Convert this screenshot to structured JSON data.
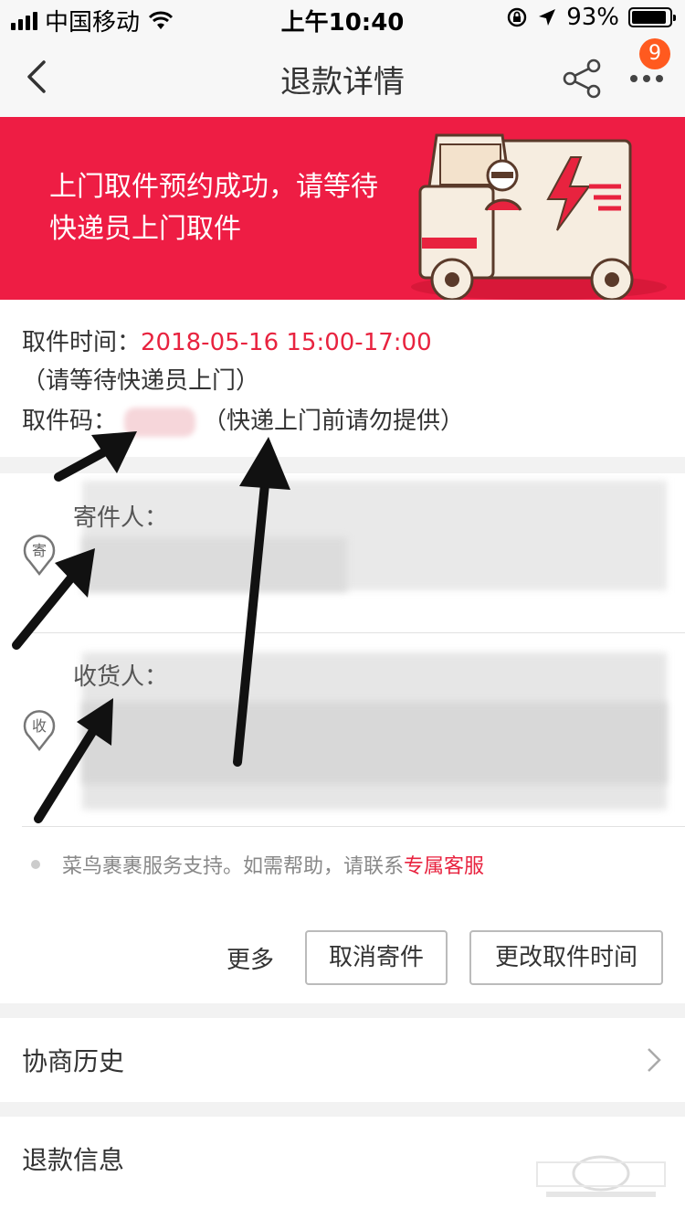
{
  "status_bar": {
    "carrier": "中国移动",
    "time": "上午10:40",
    "battery_percent": "93%",
    "battery_level": 0.93
  },
  "nav": {
    "title": "退款详情",
    "badge_count": "9"
  },
  "banner": {
    "message": "上门取件预约成功，请等待快递员上门取件"
  },
  "pickup": {
    "time_label": "取件时间：",
    "time_value": "2018-05-16 15:00-17:00",
    "time_note": "（请等待快递员上门）",
    "code_label": "取件码：",
    "code_note": "（快递上门前请勿提供）"
  },
  "address": {
    "sender_icon": "寄",
    "sender_label": "寄件人：",
    "receiver_icon": "收",
    "receiver_label": "收货人：",
    "support_text": "菜鸟裹裹服务支持。如需帮助，请联系",
    "support_link": "专属客服"
  },
  "actions": {
    "more": "更多",
    "cancel": "取消寄件",
    "change_time": "更改取件时间"
  },
  "rows": {
    "history": "协商历史",
    "refund_info": "退款信息"
  },
  "colors": {
    "banner": "#ee1d44",
    "accent_red": "#e8233f",
    "badge": "#ff5a1f"
  }
}
